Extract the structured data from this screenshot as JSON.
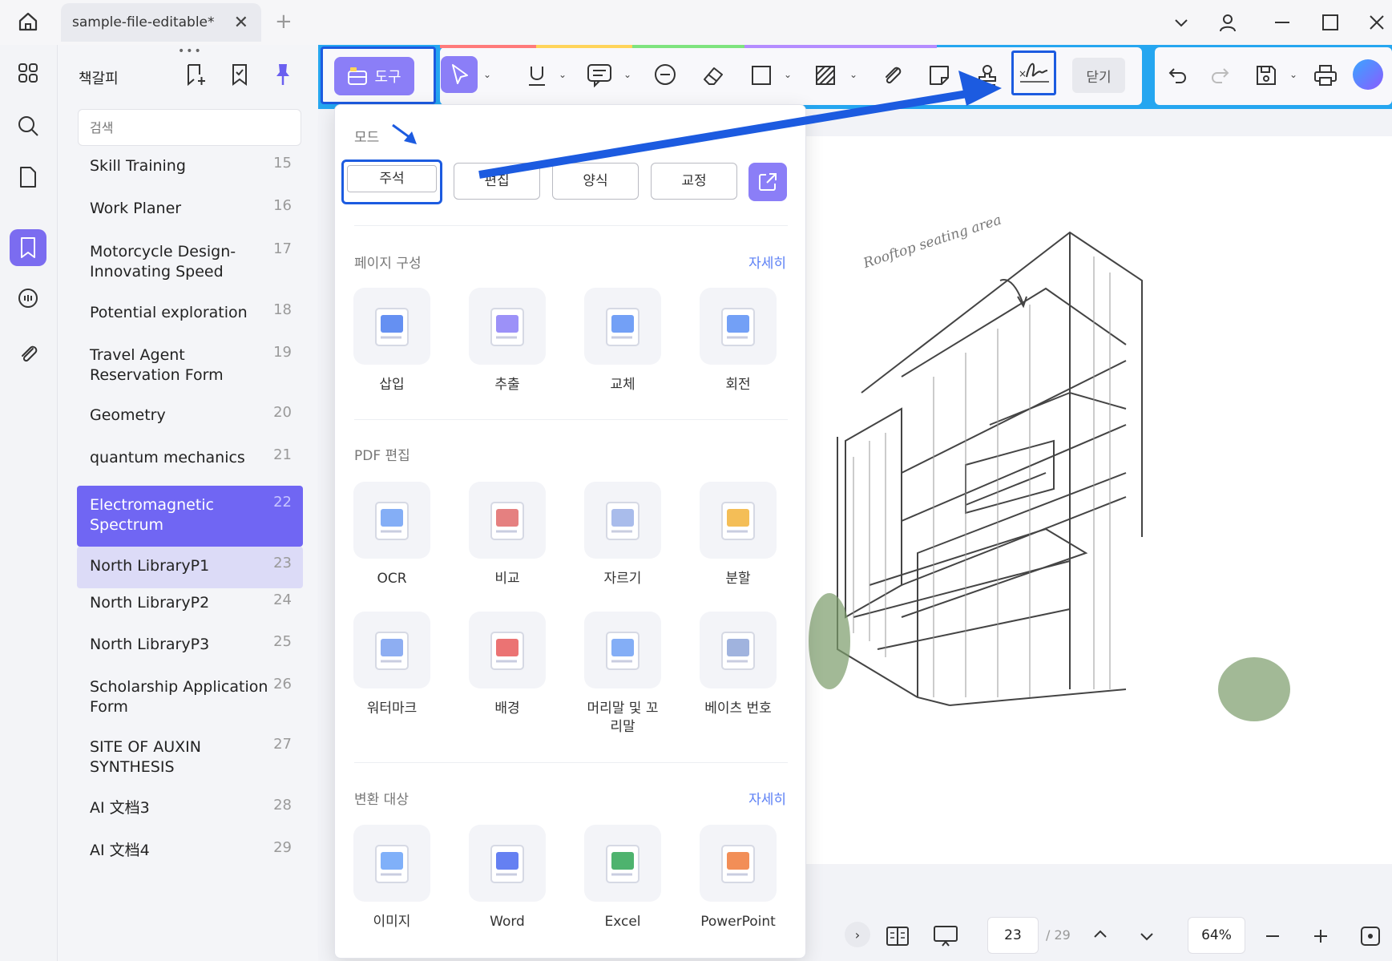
{
  "titlebar": {
    "tab_title": "sample-file-editable*"
  },
  "panel": {
    "title": "책갈피",
    "search_placeholder": "검색",
    "bookmarks": [
      {
        "label": "Skill Training",
        "num": "15"
      },
      {
        "label": "Work Planer",
        "num": "16"
      },
      {
        "label": "Motorcycle Design-\nInnovating Speed",
        "num": "17"
      },
      {
        "label": "Potential exploration",
        "num": "18"
      },
      {
        "label": "Travel Agent\nReservation Form",
        "num": "19"
      },
      {
        "label": "Geometry",
        "num": "20"
      },
      {
        "label": "quantum mechanics",
        "num": "21"
      },
      {
        "label": "Electromagnetic\nSpectrum",
        "num": "22"
      },
      {
        "label": "North LibraryP1",
        "num": "23"
      },
      {
        "label": "North LibraryP2",
        "num": "24"
      },
      {
        "label": "North LibraryP3",
        "num": "25"
      },
      {
        "label": "Scholarship Application\nForm",
        "num": "26"
      },
      {
        "label": "SITE OF AUXIN\nSYNTHESIS",
        "num": "27"
      },
      {
        "label": "AI 文档3",
        "num": "28"
      },
      {
        "label": "AI 文档4",
        "num": "29"
      }
    ]
  },
  "toolbar": {
    "tool_label": "도구",
    "close_label": "닫기"
  },
  "dropdown": {
    "mode_title": "모드",
    "modes": [
      "주석",
      "편집",
      "양식",
      "교정"
    ],
    "page_section": {
      "title": "페이지 구성",
      "more": "자세히",
      "items": [
        "삽입",
        "추출",
        "교체",
        "회전"
      ]
    },
    "pdf_section": {
      "title": "PDF 편집",
      "items": [
        "OCR",
        "비교",
        "자르기",
        "분할",
        "워터마크",
        "배경",
        "머리말 및 꼬\n리말",
        "베이츠 번호"
      ]
    },
    "convert_section": {
      "title": "변환 대상",
      "more": "자세히",
      "items": [
        "이미지",
        "Word",
        "Excel",
        "PowerPoint"
      ]
    }
  },
  "document": {
    "annotation": "Rooftop seating area"
  },
  "statusbar": {
    "page": "23",
    "total": "/ 29",
    "zoom": "64%"
  },
  "colors": {
    "accent": "#7066f3",
    "highlight_box": "#1c5be0",
    "toolbar_bg": "#25a6f0"
  }
}
